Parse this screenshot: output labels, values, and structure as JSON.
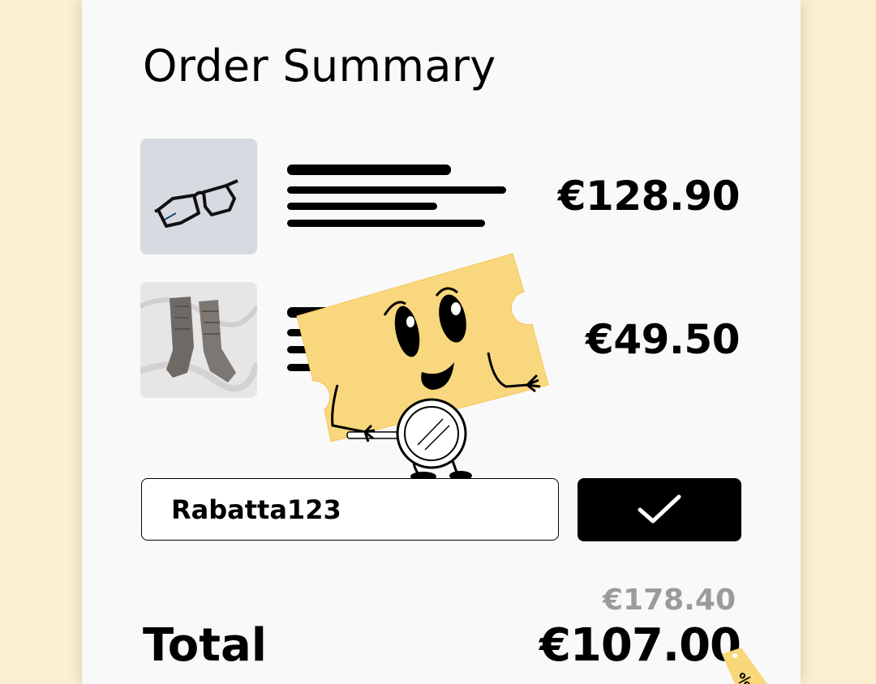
{
  "page": {
    "title": "Order Summary"
  },
  "items": [
    {
      "image": "glasses-product-photo",
      "price": "€128.90"
    },
    {
      "image": "socks-product-photo",
      "price": "€49.50"
    }
  ],
  "coupon": {
    "value": "Rabatta123",
    "apply_icon": "checkmark-icon"
  },
  "totals": {
    "original": "€178.40",
    "label": "Total",
    "discounted": "€107.00"
  },
  "decorations": {
    "mascot": "coupon-ticket-mascot",
    "tag": "discount-tag-icon"
  },
  "colors": {
    "background": "#fbf0d2",
    "card": "#f9f9f9",
    "mascot": "#f9d77e",
    "strike_price": "#9b9b9b"
  }
}
